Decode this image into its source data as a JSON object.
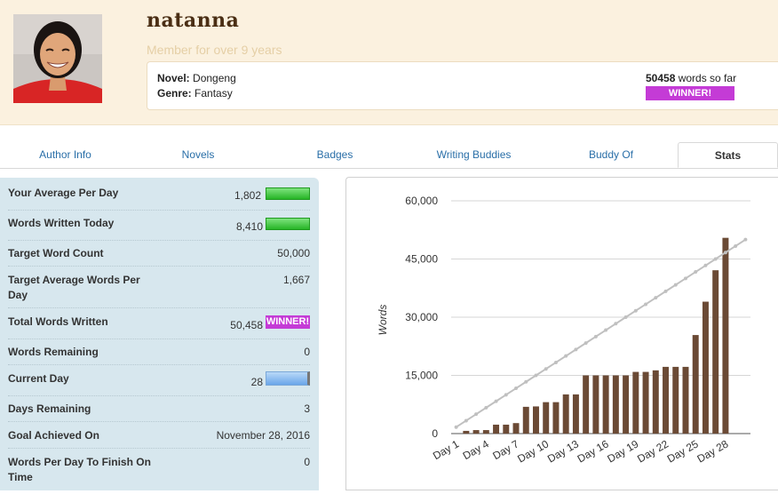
{
  "profile": {
    "username": "natanna",
    "member_since": "Member for over 9 years",
    "novel_label": "Novel:",
    "novel_title": "Dongeng",
    "genre_label": "Genre:",
    "genre": "Fantasy",
    "words_count": "50458",
    "words_suffix": " words so far",
    "winner_badge": "WINNER!"
  },
  "tabs": [
    {
      "label": "Author Info"
    },
    {
      "label": "Novels"
    },
    {
      "label": "Badges"
    },
    {
      "label": "Writing Buddies"
    },
    {
      "label": "Buddy Of"
    },
    {
      "label": "Stats"
    }
  ],
  "stats": [
    {
      "label": "Your Average Per Day",
      "value": "1,802",
      "indicator": "green-bar"
    },
    {
      "label": "Words Written Today",
      "value": "8,410",
      "indicator": "green-bar"
    },
    {
      "label": "Target Word Count",
      "value": "50,000"
    },
    {
      "label": "Target Average Words Per Day",
      "value": "1,667"
    },
    {
      "label": "Total Words Written",
      "value": "50,458",
      "badge": "WINNER!"
    },
    {
      "label": "Words Remaining",
      "value": "0"
    },
    {
      "label": "Current Day",
      "value": "28",
      "indicator": "blue-bar"
    },
    {
      "label": "Days Remaining",
      "value": "3"
    },
    {
      "label": "Goal Achieved On",
      "value": "November 28, 2016"
    },
    {
      "label": "Words Per Day To Finish On Time",
      "value": "0"
    }
  ],
  "colors": {
    "bar": "#6b4a35",
    "target_line": "#c0c0c0",
    "winner": "#c43bd6",
    "header_bg": "#fbf1df",
    "panel_bg": "#d7e7ee",
    "tab_link": "#2a6fa8"
  },
  "chart_data": {
    "type": "bar",
    "ylabel": "Words",
    "ylim": [
      0,
      60000
    ],
    "y_ticks": [
      "0",
      "15,000",
      "30,000",
      "45,000",
      "60,000"
    ],
    "y_tick_values": [
      0,
      15000,
      30000,
      45000,
      60000
    ],
    "x_tick_labels": [
      "Day 1",
      "Day 4",
      "Day 7",
      "Day 10",
      "Day 13",
      "Day 16",
      "Day 19",
      "Day 22",
      "Day 25",
      "Day 28"
    ],
    "x_tick_days": [
      1,
      4,
      7,
      10,
      13,
      16,
      19,
      22,
      25,
      28
    ],
    "days": 30,
    "values": [
      0,
      700,
      900,
      900,
      2300,
      2300,
      2700,
      6900,
      7000,
      8100,
      8100,
      10100,
      10100,
      15000,
      15000,
      15000,
      15000,
      15000,
      15900,
      15900,
      16300,
      17200,
      17200,
      17200,
      25400,
      34000,
      42100,
      50458
    ],
    "target_line": {
      "start": 1667,
      "end": 50000
    }
  }
}
